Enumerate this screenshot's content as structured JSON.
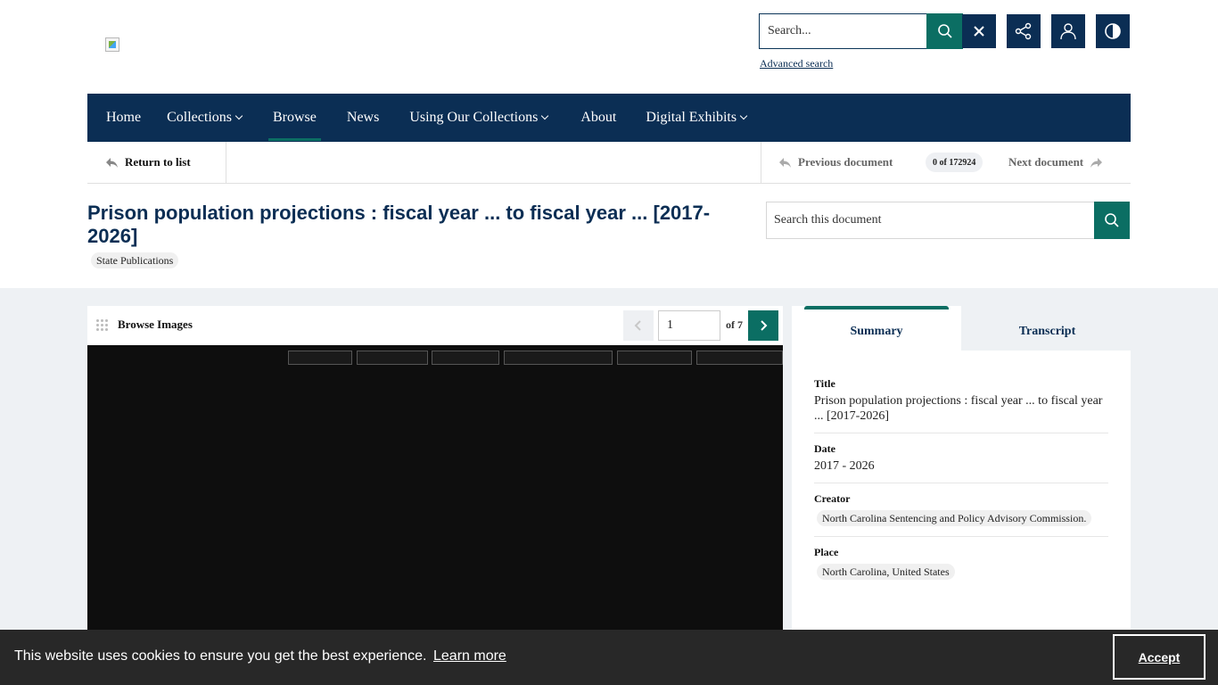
{
  "header": {
    "search_placeholder": "Search...",
    "advanced_search": "Advanced search",
    "clear_icon": "close-icon",
    "share_icon": "share-icon",
    "user_icon": "user-icon",
    "contrast_icon": "contrast-icon"
  },
  "nav": {
    "items": [
      {
        "label": "Home",
        "dropdown": false
      },
      {
        "label": "Collections",
        "dropdown": true
      },
      {
        "label": "Browse",
        "dropdown": false,
        "active": true
      },
      {
        "label": "News",
        "dropdown": false
      },
      {
        "label": "Using Our Collections",
        "dropdown": true
      },
      {
        "label": "About",
        "dropdown": false
      },
      {
        "label": "Digital Exhibits",
        "dropdown": true
      }
    ]
  },
  "doc_bar": {
    "return_label": "Return to list",
    "prev_label": "Previous document",
    "counter": "0 of 172924",
    "next_label": "Next document"
  },
  "document": {
    "title": "Prison population projections : fiscal year ... to fiscal year ... [2017-2026]",
    "collection": "State Publications",
    "search_placeholder": "Search this document"
  },
  "viewer": {
    "browse_label": "Browse Images",
    "page_value": "1",
    "page_total": "of 7"
  },
  "panel": {
    "tabs": [
      "Summary",
      "Transcript"
    ],
    "active_tab": "Summary",
    "fields": {
      "title_label": "Title",
      "title_value": "Prison population projections : fiscal year ... to fiscal year ... [2017-2026]",
      "date_label": "Date",
      "date_value": "2017 - 2026",
      "creator_label": "Creator",
      "creator_value": "North Carolina Sentencing and Policy Advisory Commission.",
      "place_label": "Place",
      "place_value": "North Carolina, United States"
    }
  },
  "cookie": {
    "message": "This website uses cookies to ensure you get the best experience.",
    "learn_more": "Learn more",
    "accept": "Accept"
  },
  "colors": {
    "navy": "#0b2e54",
    "teal": "#0b6e63",
    "content_bg": "#eef1f4",
    "cookie_bg": "#282828"
  }
}
